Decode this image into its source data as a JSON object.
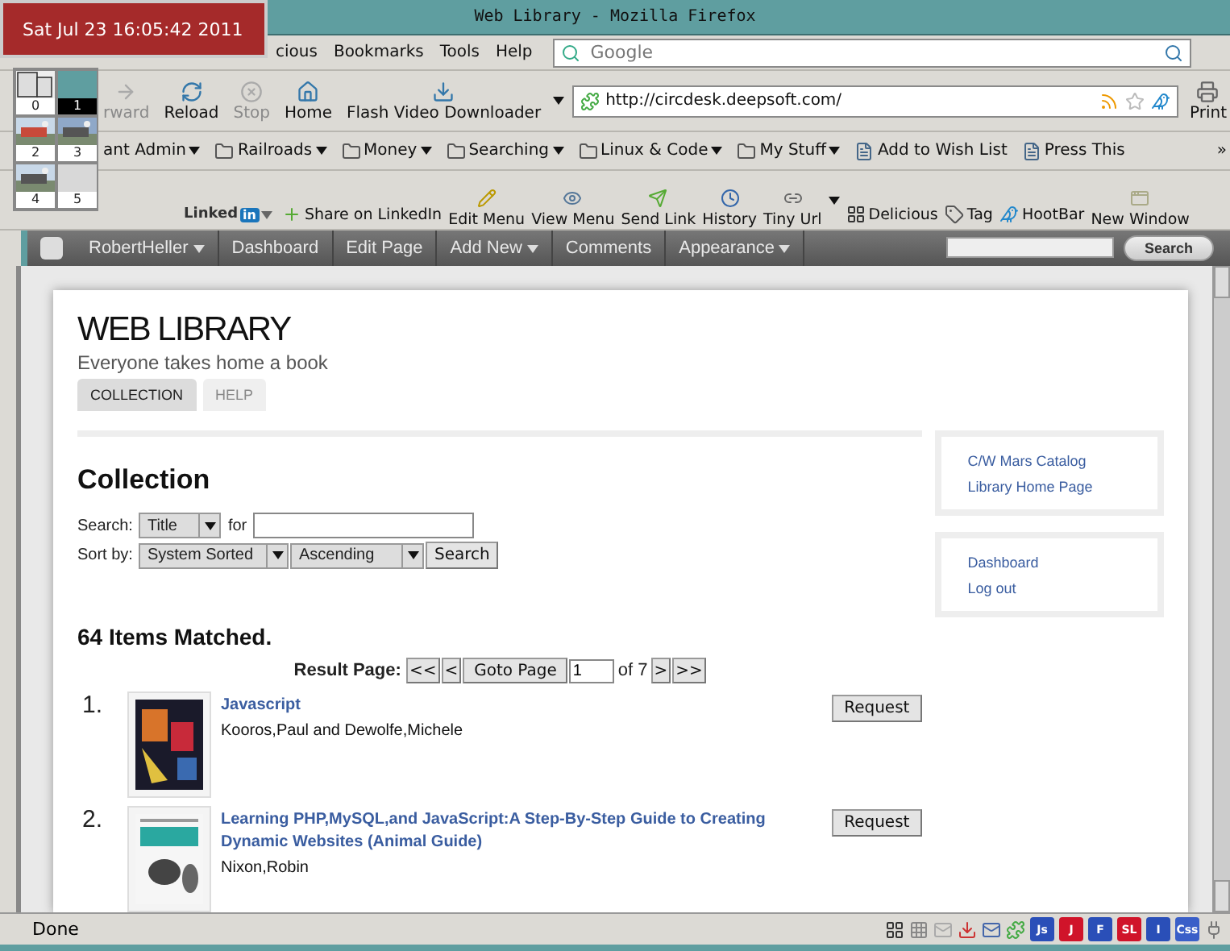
{
  "clock": {
    "text": "Sat Jul 23 16:05:42 2011"
  },
  "workspaces": [
    {
      "label": "0",
      "kind": "windows",
      "selected": false
    },
    {
      "label": "1",
      "kind": "blank",
      "selected": true
    },
    {
      "label": "2",
      "kind": "picture",
      "selected": false
    },
    {
      "label": "3",
      "kind": "picture",
      "selected": false
    },
    {
      "label": "4",
      "kind": "picture",
      "selected": false
    },
    {
      "label": "5",
      "kind": "blank",
      "selected": false
    }
  ],
  "window": {
    "title": "Web Library - Mozilla Firefox"
  },
  "menu_bar": {
    "items": [
      "cious",
      "Bookmarks",
      "Tools",
      "Help"
    ],
    "search": {
      "placeholder": "Google"
    }
  },
  "nav_toolbar": {
    "buttons": [
      {
        "label": "rward",
        "kind": "forward",
        "disabled": true
      },
      {
        "label": "Reload",
        "kind": "reload",
        "disabled": false
      },
      {
        "label": "Stop",
        "kind": "stop",
        "disabled": true
      },
      {
        "label": "Home",
        "kind": "home",
        "disabled": false
      },
      {
        "label": "Flash Video Downloader",
        "kind": "download",
        "disabled": false
      }
    ],
    "url": "http://circdesk.deepsoft.com/",
    "print": "Print"
  },
  "bookmarks_bar": {
    "items": [
      {
        "label": "ant Admin",
        "kind": "menu"
      },
      {
        "label": "Railroads",
        "kind": "folder"
      },
      {
        "label": "Money",
        "kind": "folder"
      },
      {
        "label": "Searching",
        "kind": "folder"
      },
      {
        "label": "Linux & Code",
        "kind": "folder"
      },
      {
        "label": "My Stuff",
        "kind": "folder"
      },
      {
        "label": "Add to Wish List",
        "kind": "page"
      },
      {
        "label": "Press This",
        "kind": "page"
      }
    ],
    "overflow": "»"
  },
  "addon_toolbar": {
    "linkedin": {
      "label": "Linked",
      "badge": "in"
    },
    "items": [
      {
        "label": "Share on LinkedIn",
        "kind": "share"
      },
      {
        "label": "Edit Menu",
        "kind": "edit"
      },
      {
        "label": "View Menu",
        "kind": "view"
      },
      {
        "label": "Send Link",
        "kind": "send"
      },
      {
        "label": "History",
        "kind": "history"
      },
      {
        "label": "Tiny Url",
        "kind": "tinyurl"
      },
      {
        "label": "Delicious",
        "kind": "delicious"
      },
      {
        "label": "Tag",
        "kind": "tag"
      },
      {
        "label": "HootBar",
        "kind": "hootbar"
      },
      {
        "label": "New Window",
        "kind": "newwindow"
      }
    ]
  },
  "admin_bar": {
    "items": [
      {
        "label": "RobertHeller",
        "dropdown": true
      },
      {
        "label": "Dashboard",
        "dropdown": false
      },
      {
        "label": "Edit Page",
        "dropdown": false
      },
      {
        "label": "Add New",
        "dropdown": true
      },
      {
        "label": "Comments",
        "dropdown": false
      },
      {
        "label": "Appearance",
        "dropdown": true
      }
    ],
    "search_button": "Search"
  },
  "page": {
    "site_title": "WEB LIBRARY",
    "tagline": "Everyone takes home a book",
    "tabs": [
      {
        "label": "COLLECTION",
        "selected": true
      },
      {
        "label": "HELP",
        "selected": false
      }
    ],
    "heading": "Collection",
    "search_form": {
      "search_label": "Search:",
      "field_select": "Title",
      "for_label": "for",
      "sort_label": "Sort by:",
      "sort_select": "System Sorted",
      "order_select": "Ascending",
      "button": "Search"
    },
    "matched": "64 Items Matched.",
    "pager": {
      "label": "Result Page:",
      "first": "<<",
      "prev": "<",
      "goto": "Goto Page",
      "page": "1",
      "of": "of 7",
      "next": ">",
      "last": ">>"
    },
    "items": [
      {
        "number": "1.",
        "title": "Javascript",
        "author": "Kooros,Paul and Dewolfe,Michele",
        "button": "Request"
      },
      {
        "number": "2.",
        "title": "Learning PHP,MySQL,and JavaScript:A Step-By-Step Guide to Creating Dynamic Websites (Animal Guide)",
        "author": "Nixon,Robin",
        "button": "Request"
      }
    ],
    "sidebar": [
      {
        "links": [
          "C/W Mars Catalog",
          "Library Home Page"
        ]
      },
      {
        "links": [
          "Dashboard",
          "Log out"
        ]
      }
    ]
  },
  "status_bar": {
    "text": "Done",
    "addons": [
      {
        "label": "Js",
        "color": "#2a4fb8"
      },
      {
        "label": "J",
        "color": "#d0142a"
      },
      {
        "label": "F",
        "color": "#2a4fb8"
      },
      {
        "label": "SL",
        "color": "#d0142a"
      },
      {
        "label": "I",
        "color": "#2a4fb8"
      },
      {
        "label": "Css",
        "color": "#3a5fc8"
      }
    ]
  }
}
